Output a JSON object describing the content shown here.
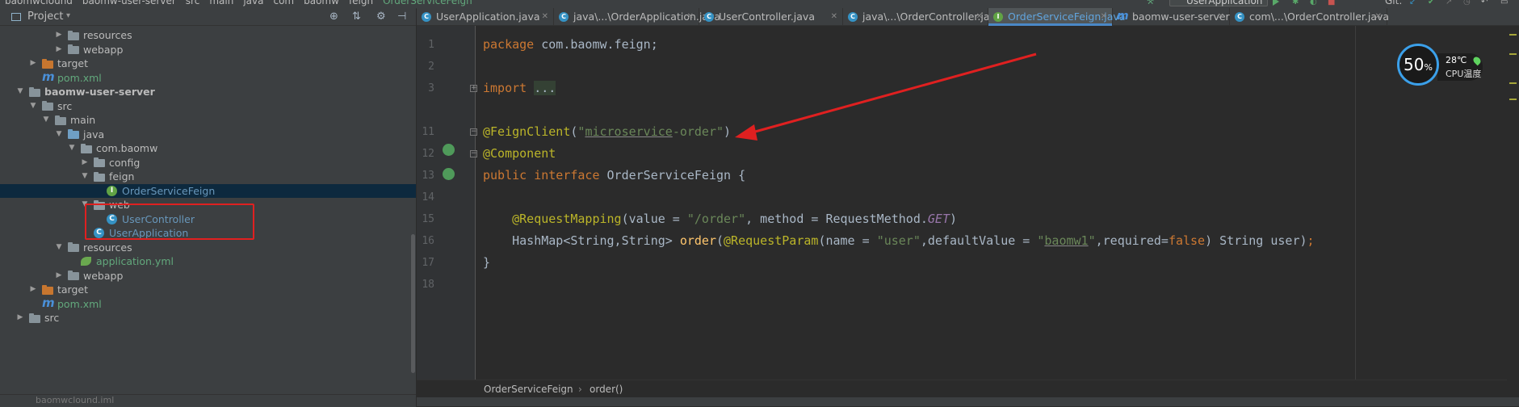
{
  "navbar": {
    "crumbs": [
      "baomwclound",
      "baomw-user-server",
      "src",
      "main",
      "java",
      "com",
      "baomw",
      "feign"
    ],
    "leaf": "OrderServiceFeign",
    "run_config": "UserApplication",
    "git_label": "Git:"
  },
  "project": {
    "title": "Project",
    "dropdown": "▾",
    "items": [
      {
        "label": "resources",
        "depth": 4,
        "arrow": "▶",
        "icon": "folder"
      },
      {
        "label": "webapp",
        "depth": 4,
        "arrow": "▶",
        "icon": "folder"
      },
      {
        "label": "target",
        "depth": 2,
        "arrow": "▶",
        "icon": "folder-orange"
      },
      {
        "label": "pom.xml",
        "depth": 2,
        "arrow": "",
        "icon": "maven"
      },
      {
        "label": "baomw-user-server",
        "depth": 1,
        "arrow": "▼",
        "icon": "module"
      },
      {
        "label": "src",
        "depth": 2,
        "arrow": "▼",
        "icon": "folder"
      },
      {
        "label": "main",
        "depth": 3,
        "arrow": "▼",
        "icon": "folder"
      },
      {
        "label": "java",
        "depth": 4,
        "arrow": "▼",
        "icon": "folder-blue"
      },
      {
        "label": "com.baomw",
        "depth": 5,
        "arrow": "▼",
        "icon": "package"
      },
      {
        "label": "config",
        "depth": 6,
        "arrow": "▶",
        "icon": "package"
      },
      {
        "label": "feign",
        "depth": 6,
        "arrow": "▼",
        "icon": "package"
      },
      {
        "label": "OrderServiceFeign",
        "depth": 7,
        "arrow": "",
        "icon": "interface",
        "selected": true
      },
      {
        "label": "web",
        "depth": 6,
        "arrow": "▼",
        "icon": "package"
      },
      {
        "label": "UserController",
        "depth": 7,
        "arrow": "",
        "icon": "class"
      },
      {
        "label": "UserApplication",
        "depth": 6,
        "arrow": "",
        "icon": "spring-class"
      },
      {
        "label": "resources",
        "depth": 4,
        "arrow": "▼",
        "icon": "folder"
      },
      {
        "label": "application.yml",
        "depth": 5,
        "arrow": "",
        "icon": "yml"
      },
      {
        "label": "webapp",
        "depth": 4,
        "arrow": "▶",
        "icon": "folder"
      },
      {
        "label": "target",
        "depth": 2,
        "arrow": "▶",
        "icon": "folder-orange"
      },
      {
        "label": "pom.xml",
        "depth": 2,
        "arrow": "",
        "icon": "maven"
      },
      {
        "label": "src",
        "depth": 1,
        "arrow": "▶",
        "icon": "folder"
      }
    ],
    "bottom_item": "baomwclound.iml"
  },
  "tabs": [
    {
      "label": "UserApplication.java",
      "icon": "C"
    },
    {
      "label": "java\\...\\OrderApplication.java",
      "icon": "C"
    },
    {
      "label": "UserController.java",
      "icon": "C"
    },
    {
      "label": "java\\...\\OrderController.java",
      "icon": "C"
    },
    {
      "label": "OrderServiceFeign.java",
      "icon": "I",
      "active": true
    },
    {
      "label": "baomw-user-server",
      "icon": "m"
    },
    {
      "label": "com\\...\\OrderController.java",
      "icon": "C"
    }
  ],
  "editor": {
    "line_numbers": [
      "1",
      "2",
      "3",
      "11",
      "12",
      "13",
      "14",
      "15",
      "16",
      "17",
      "18"
    ],
    "code": {
      "l1_kw": "package",
      "l1_rest": " com.baomw.feign;",
      "l3_kw": "import",
      "l3_fold": "...",
      "l11_an": "@FeignClient",
      "l11_p1": "(",
      "l11_s1": "\"",
      "l11_u": "microservice",
      "l11_s2": "-order\"",
      "l11_p2": ")",
      "l12_an": "@Component",
      "l13_kw1": "public",
      "l13_kw2": "interface",
      "l13_rest": " OrderServiceFeign {",
      "l15_an": "@RequestMapping",
      "l15_a": "(value = ",
      "l15_s": "\"/order\"",
      "l15_b": ", method = RequestMethod.",
      "l15_it": "GET",
      "l15_c": ")",
      "l16_a": "HashMap<String,String> ",
      "l16_fn": "order",
      "l16_b": "(",
      "l16_an": "@RequestParam",
      "l16_c": "(name = ",
      "l16_s1": "\"user\"",
      "l16_d": ",defaultValue = ",
      "l16_s2q": "\"",
      "l16_s2u": "baomw1",
      "l16_s2e": "\"",
      "l16_e": ",required=",
      "l16_kw": "false",
      "l16_f": ") String user)",
      "l16_semi": ";",
      "l17": "}"
    },
    "breadcrumb": [
      "OrderServiceFeign",
      "order()"
    ],
    "breadcrumb_sep": "›"
  },
  "widget": {
    "cpu_usage": "50",
    "cpu_unit": "%",
    "temperature": "28℃",
    "temp_label": "CPU温度"
  },
  "colors": {
    "annotation_box": "#e02020",
    "arrow": "#e02020",
    "active_tab": "#4a88c7"
  }
}
